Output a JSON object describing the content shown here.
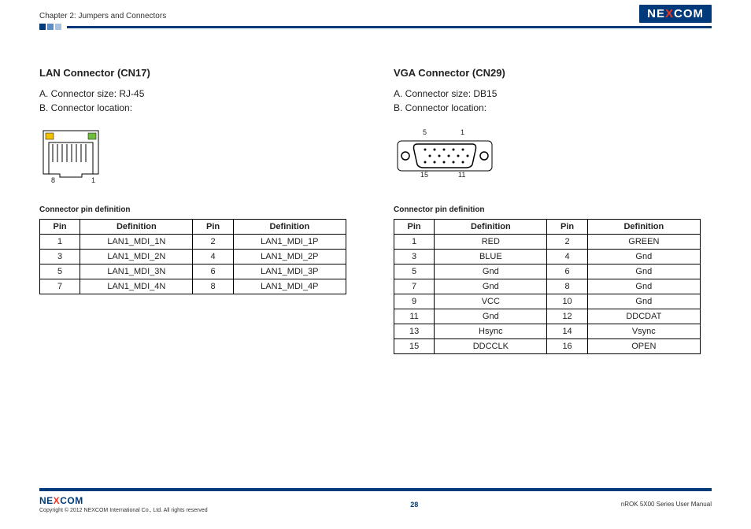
{
  "header": {
    "chapter": "Chapter 2: Jumpers and Connectors",
    "logo_pre": "NE",
    "logo_x": "X",
    "logo_post": "COM"
  },
  "left": {
    "title": "LAN Connector (CN17)",
    "specA": "A. Connector size: RJ-45",
    "specB": "B. Connector location:",
    "diagram": {
      "pin8": "8",
      "pin1": "1"
    },
    "table_caption": "Connector pin definition",
    "headers": {
      "pin": "Pin",
      "def": "Definition"
    },
    "rows": [
      {
        "p1": "1",
        "d1": "LAN1_MDI_1N",
        "p2": "2",
        "d2": "LAN1_MDI_1P"
      },
      {
        "p1": "3",
        "d1": "LAN1_MDI_2N",
        "p2": "4",
        "d2": "LAN1_MDI_2P"
      },
      {
        "p1": "5",
        "d1": "LAN1_MDI_3N",
        "p2": "6",
        "d2": "LAN1_MDI_3P"
      },
      {
        "p1": "7",
        "d1": "LAN1_MDI_4N",
        "p2": "8",
        "d2": "LAN1_MDI_4P"
      }
    ]
  },
  "right": {
    "title": "VGA Connector (CN29)",
    "specA": "A. Connector size: DB15",
    "specB": "B. Connector location:",
    "diagram": {
      "t5": "5",
      "t1": "1",
      "b15": "15",
      "b11": "11"
    },
    "table_caption": "Connector pin definition",
    "headers": {
      "pin": "Pin",
      "def": "Definition"
    },
    "rows": [
      {
        "p1": "1",
        "d1": "RED",
        "p2": "2",
        "d2": "GREEN"
      },
      {
        "p1": "3",
        "d1": "BLUE",
        "p2": "4",
        "d2": "Gnd"
      },
      {
        "p1": "5",
        "d1": "Gnd",
        "p2": "6",
        "d2": "Gnd"
      },
      {
        "p1": "7",
        "d1": "Gnd",
        "p2": "8",
        "d2": "Gnd"
      },
      {
        "p1": "9",
        "d1": "VCC",
        "p2": "10",
        "d2": "Gnd"
      },
      {
        "p1": "11",
        "d1": "Gnd",
        "p2": "12",
        "d2": "DDCDAT"
      },
      {
        "p1": "13",
        "d1": "Hsync",
        "p2": "14",
        "d2": "Vsync"
      },
      {
        "p1": "15",
        "d1": "DDCCLK",
        "p2": "16",
        "d2": "OPEN"
      }
    ]
  },
  "footer": {
    "logo_pre": "NE",
    "logo_x": "X",
    "logo_post": "COM",
    "copyright": "Copyright © 2012 NEXCOM International Co., Ltd. All rights reserved",
    "page": "28",
    "manual": "nROK 5X00 Series User Manual"
  }
}
